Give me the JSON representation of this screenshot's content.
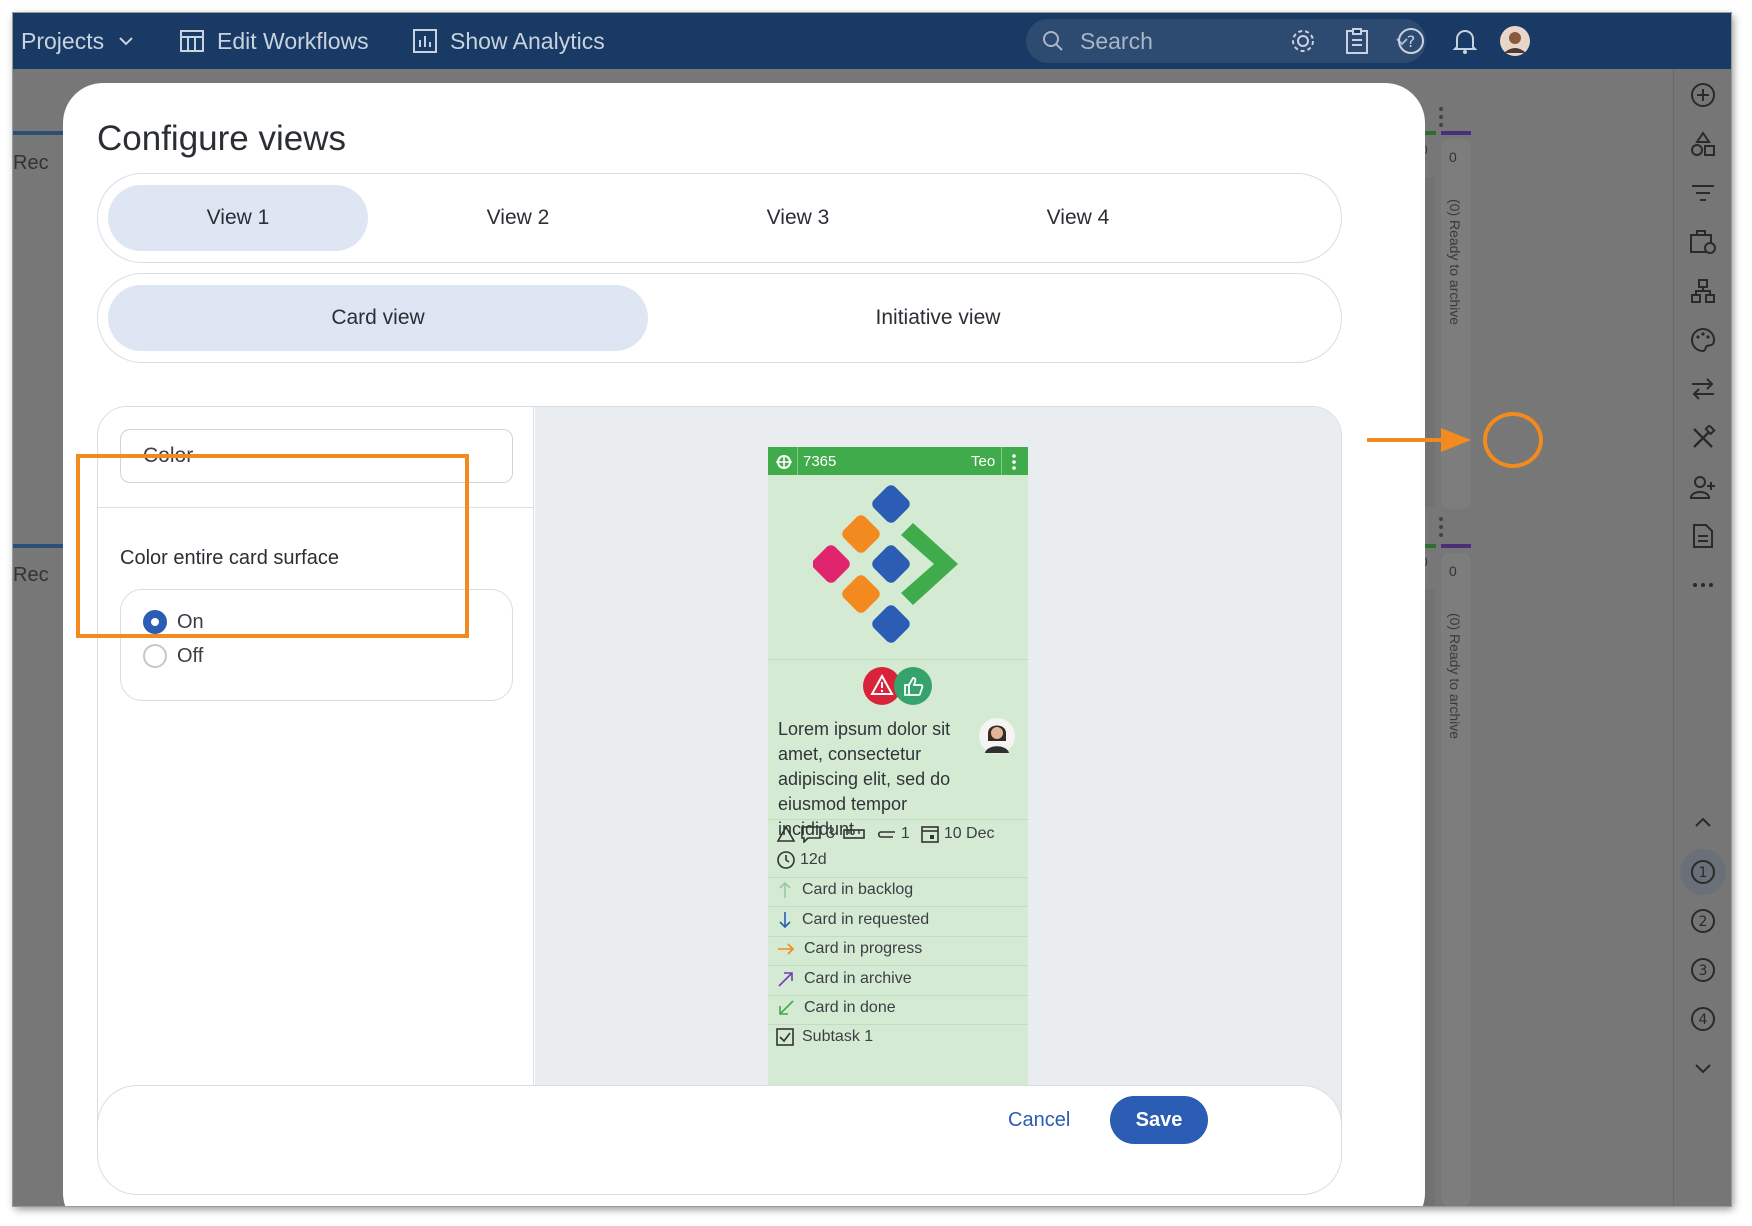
{
  "topbar": {
    "projects_label": "Projects",
    "edit_workflows_label": "Edit Workflows",
    "show_analytics_label": "Show Analytics",
    "search_placeholder": "Search"
  },
  "board": {
    "column_label_top": "Rec",
    "column_label_bottom": "Rec",
    "archive_lane_label": "(0) Ready to archive",
    "archive_count": "0",
    "wip_count": "0"
  },
  "modal": {
    "title": "Configure views",
    "view_tabs": [
      "View 1",
      "View 2",
      "View 3",
      "View 4"
    ],
    "active_view": "View 1",
    "mode_tabs": [
      "Card view",
      "Initiative view"
    ],
    "active_mode": "Card view",
    "setting_field": "Color",
    "section_title": "Color entire card surface",
    "options": [
      {
        "label": "On",
        "checked": true
      },
      {
        "label": "Off",
        "checked": false
      }
    ],
    "cancel_label": "Cancel",
    "save_label": "Save"
  },
  "card": {
    "id": "7365",
    "owner": "Teo",
    "description": "Lorem ipsum dolor sit amet, consectetur adipiscing elit, sed do eiusmod tempor incididunt",
    "comments_count": "3",
    "attachments_count": "1",
    "due_date": "10 Dec",
    "age": "12d",
    "relations": [
      {
        "label": "Card in backlog",
        "icon": "arrow-up-icon",
        "color": "#9ac7a0"
      },
      {
        "label": "Card in requested",
        "icon": "arrow-down-icon",
        "color": "#2a5db3"
      },
      {
        "label": "Card in progress",
        "icon": "arrow-right-icon",
        "color": "#f28a1f"
      },
      {
        "label": "Card in archive",
        "icon": "arrow-up-right-icon",
        "color": "#6f3fb8"
      },
      {
        "label": "Card in done",
        "icon": "arrow-down-left-icon",
        "color": "#40ab4a"
      }
    ],
    "subtask": "Subtask 1",
    "header_color": "#40ab4a",
    "surface_color": "#d5ead2"
  },
  "colors": {
    "accent": "#2a5db3",
    "highlight": "#f28a1f",
    "topbar": "#183a64"
  }
}
